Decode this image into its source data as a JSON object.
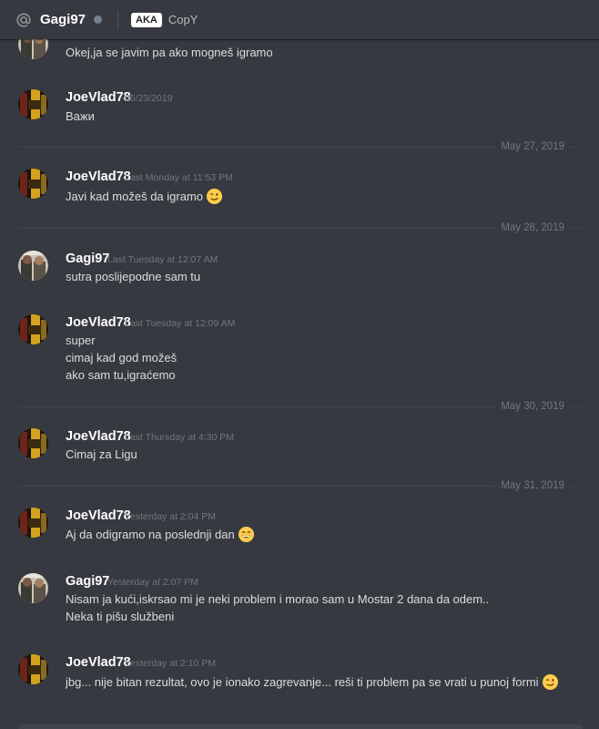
{
  "header": {
    "icon": "at-sign-icon",
    "username": "Gagi97",
    "aka_badge": "AKA",
    "aka_value": "CopY",
    "status_color": "#747f8d"
  },
  "messages": [
    {
      "author": "",
      "timestamp": "",
      "lines": [
        "Okej,ja se javim pa ako mogneš igramo"
      ]
    },
    {
      "author": "JoeVlad78",
      "timestamp": "05/23/2019",
      "lines": [
        "Важи"
      ]
    },
    {
      "author": "JoeVlad78",
      "timestamp": "Last Monday at 11:53 PM",
      "lines": [
        "Javi kad možeš da igramo"
      ],
      "emoji": "winking-face-emoji"
    },
    {
      "author": "Gagi97",
      "timestamp": "Last Tuesday at 12:07 AM",
      "lines": [
        "sutra poslijepodne sam tu"
      ]
    },
    {
      "author": "JoeVlad78",
      "timestamp": "Last Tuesday at 12:09 AM",
      "lines": [
        "super",
        "cimaj kad god možeš",
        "ako sam tu,igraćemo"
      ]
    },
    {
      "author": "JoeVlad78",
      "timestamp": "Last Thursday at 4:30 PM",
      "lines": [
        "Cimaj za Ligu"
      ]
    },
    {
      "author": "JoeVlad78",
      "timestamp": "Yesterday at 2:04 PM",
      "lines": [
        "Aj da odigramo na poslednji dan"
      ],
      "emoji": "grinning-face-emoji"
    },
    {
      "author": "Gagi97",
      "timestamp": "Yesterday at 2:07 PM",
      "lines": [
        "Nisam ja kući,iskrsao mi je neki problem i morao sam u Mostar 2 dana da odem..",
        "Neka ti pišu službeni"
      ]
    },
    {
      "author": "JoeVlad78",
      "timestamp": "Yesterday at 2:10 PM",
      "lines": [
        "jbg... nije bitan rezultat, ovo je ionako zagrevanje... reši ti problem pa se vrati u punoj formi"
      ],
      "emoji": "winking-face-emoji"
    }
  ],
  "separators": [
    "May 27, 2019",
    "May 28, 2019",
    "May 30, 2019",
    "May 31, 2019"
  ]
}
